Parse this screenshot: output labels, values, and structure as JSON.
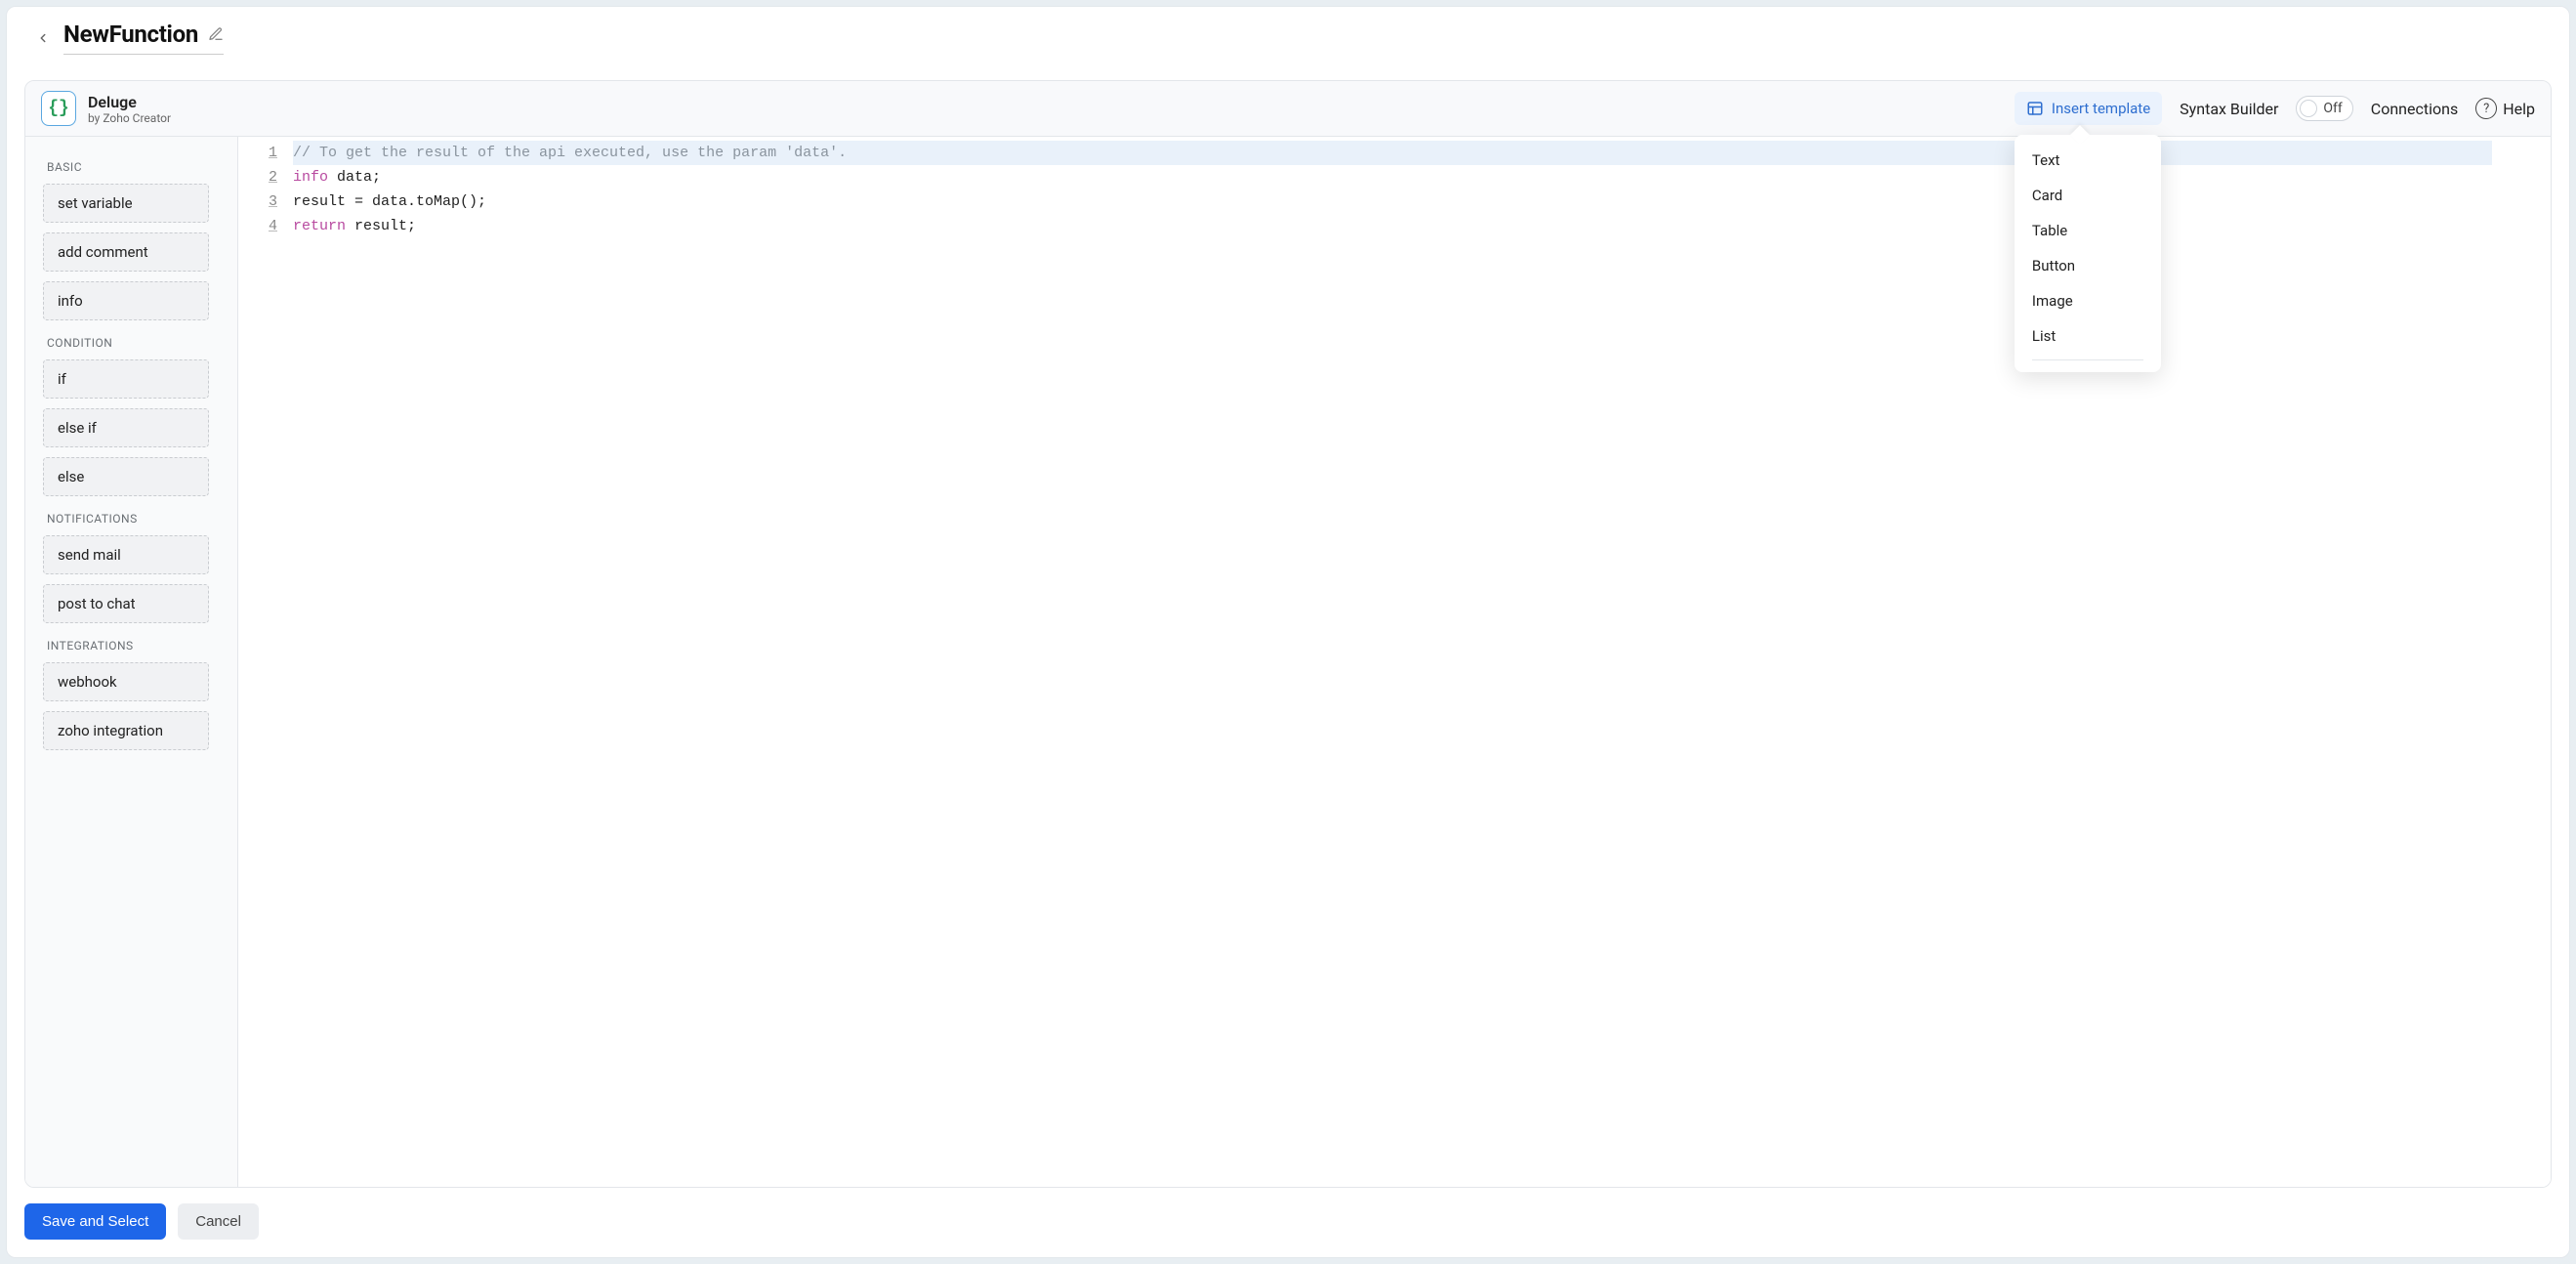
{
  "titlebar": {
    "title": "NewFunction"
  },
  "lang": {
    "name": "Deluge",
    "by": "by Zoho Creator",
    "glyph": "{}"
  },
  "toolbar": {
    "insert_template": "Insert template",
    "syntax_builder": "Syntax Builder",
    "toggle_state": "Off",
    "connections": "Connections",
    "help": "Help",
    "help_glyph": "?"
  },
  "template_menu": {
    "items": [
      "Text",
      "Card",
      "Table",
      "Button",
      "Image",
      "List"
    ]
  },
  "sidebar": {
    "groups": [
      {
        "label": "BASIC",
        "items": [
          "set variable",
          "add comment",
          "info"
        ]
      },
      {
        "label": "CONDITION",
        "items": [
          "if",
          "else if",
          "else"
        ]
      },
      {
        "label": "NOTIFICATIONS",
        "items": [
          "send mail",
          "post to chat"
        ]
      },
      {
        "label": "INTEGRATIONS",
        "items": [
          "webhook",
          "zoho integration"
        ]
      }
    ]
  },
  "code": {
    "lines": [
      "1",
      "2",
      "3",
      "4"
    ],
    "l1_comment": "// To get the result of the api executed, use the param 'data'.",
    "l2_kw": "info",
    "l2_rest": " data;",
    "l3_lhs": "result ",
    "l3_eq": "=",
    "l3_rhs": " data.toMap();",
    "l4_kw": "return",
    "l4_rest": " result;"
  },
  "footer": {
    "save": "Save and Select",
    "cancel": "Cancel"
  }
}
